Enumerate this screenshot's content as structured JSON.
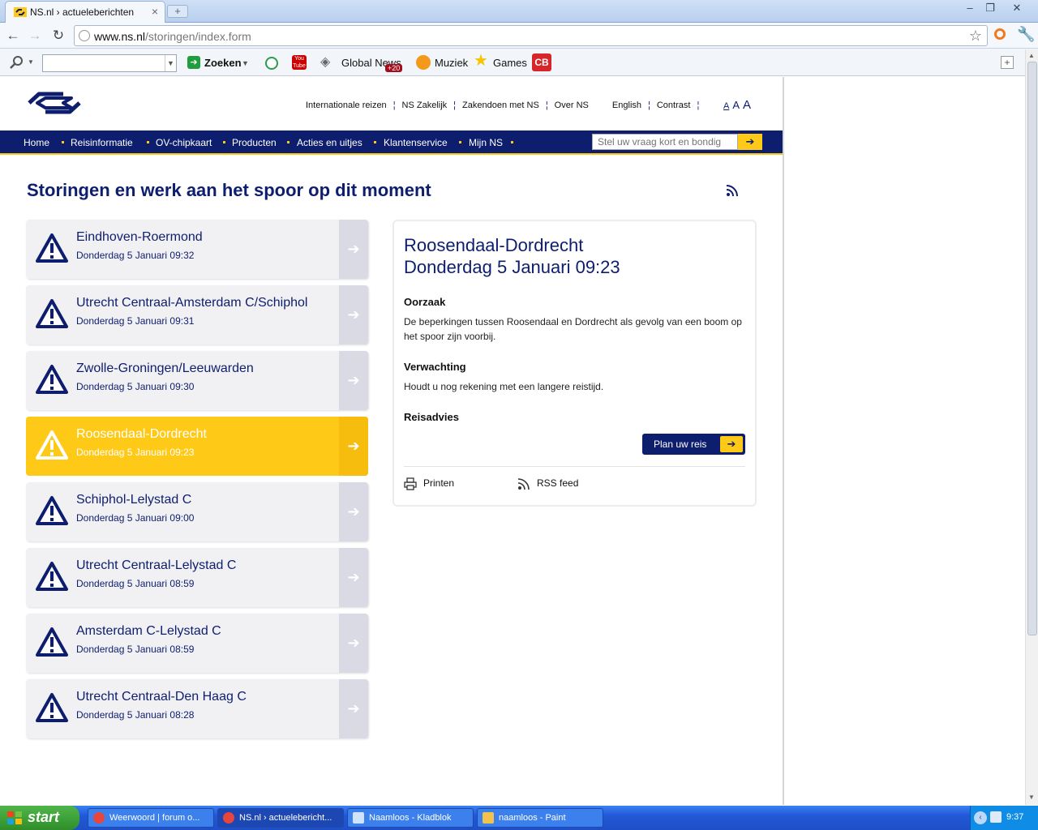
{
  "browser": {
    "tab_title": "NS.nl › actueleberichten",
    "tab_close": "×",
    "new_tab": "+",
    "url_host": "www.ns.nl",
    "url_path": "/storingen/index.form",
    "bookmarks": {
      "search_placeholder": "",
      "zoeken": "Zoeken",
      "global_news": "Global News",
      "global_news_badge": "+20",
      "muziek": "Muziek",
      "games": "Games",
      "cb": "CB"
    }
  },
  "site": {
    "top_links": [
      "Internationale reizen",
      "NS Zakelijk",
      "Zakendoen met NS",
      "Over NS"
    ],
    "lang_links": [
      "English",
      "Contrast"
    ],
    "font_sizes": [
      "A",
      "A",
      "A"
    ],
    "nav": [
      "Home",
      "Reisinformatie",
      "OV-chipkaart",
      "Producten",
      "Acties en uitjes",
      "Klantenservice",
      "Mijn NS"
    ],
    "search_placeholder": "Stel uw vraag kort en bondig",
    "search_go": "➔",
    "page_title": "Storingen en werk aan het spoor op dit moment",
    "disruptions": [
      {
        "route": "Eindhoven-Roermond",
        "date": "Donderdag 5 Januari 09:32",
        "active": false
      },
      {
        "route": "Utrecht Centraal-Amsterdam C/Schiphol",
        "date": "Donderdag 5 Januari 09:31",
        "active": false
      },
      {
        "route": "Zwolle-Groningen/Leeuwarden",
        "date": "Donderdag 5 Januari 09:30",
        "active": false
      },
      {
        "route": "Roosendaal-Dordrecht",
        "date": "Donderdag 5 Januari 09:23",
        "active": true
      },
      {
        "route": "Schiphol-Lelystad C",
        "date": "Donderdag 5 Januari 09:00",
        "active": false
      },
      {
        "route": "Utrecht Centraal-Lelystad C",
        "date": "Donderdag 5 Januari 08:59",
        "active": false
      },
      {
        "route": "Amsterdam C-Lelystad C",
        "date": "Donderdag 5 Januari 08:59",
        "active": false
      },
      {
        "route": "Utrecht Centraal-Den Haag C",
        "date": "Donderdag 5 Januari 08:28",
        "active": false
      }
    ],
    "arrow": "➔",
    "detail": {
      "route": "Roosendaal-Dordrecht",
      "date": "Donderdag 5 Januari 09:23",
      "oorzaak_label": "Oorzaak",
      "oorzaak_text": "De beperkingen tussen Roosendaal en Dordrecht als gevolg van een boom op het spoor zijn voorbij.",
      "verwachting_label": "Verwachting",
      "verwachting_text": "Houdt u nog rekening met een langere reistijd.",
      "reisadvies_label": "Reisadvies",
      "plan_button": "Plan uw reis",
      "print_label": "Printen",
      "rss_label": "RSS feed"
    },
    "colors": {
      "ns_blue": "#0e1e6e",
      "ns_yellow": "#ffc917"
    }
  },
  "taskbar": {
    "start": "start",
    "tasks": [
      "Weerwoord | forum o...",
      "NS.nl › actuelebericht...",
      "Naamloos - Kladblok",
      "naamloos - Paint"
    ],
    "clock": "9:37"
  }
}
